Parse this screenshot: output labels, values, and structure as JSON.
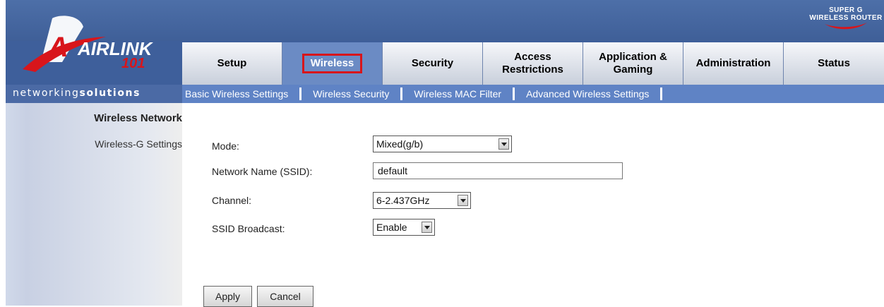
{
  "brand": {
    "line1": "SUPER G",
    "line2": "WIRELESS ROUTER"
  },
  "logo": {
    "text_main": "AIRLINK",
    "text_num": "101"
  },
  "tagline": {
    "thin": "networking",
    "bold": "solutions"
  },
  "tabs": [
    {
      "label": "Setup"
    },
    {
      "label": "Wireless"
    },
    {
      "label": "Security"
    },
    {
      "label": "Access Restrictions"
    },
    {
      "label": "Application & Gaming"
    },
    {
      "label": "Administration"
    },
    {
      "label": "Status"
    }
  ],
  "subnav": [
    {
      "label": "Basic Wireless Settings"
    },
    {
      "label": "Wireless Security"
    },
    {
      "label": "Wireless MAC Filter"
    },
    {
      "label": "Advanced Wireless Settings"
    }
  ],
  "sidebar": {
    "title": "Wireless Network",
    "item": "Wireless-G Settings"
  },
  "form": {
    "mode": {
      "label": "Mode:",
      "value": "Mixed(g/b)"
    },
    "ssid": {
      "label": "Network Name (SSID):",
      "value": "default"
    },
    "channel": {
      "label": "Channel:",
      "value": "6-2.437GHz"
    },
    "broadcast": {
      "label": "SSID Broadcast:",
      "value": "Enable"
    }
  },
  "buttons": {
    "apply": "Apply",
    "cancel": "Cancel"
  },
  "colors": {
    "header": "#3e5f9b",
    "active_tab": "#6b8bc4",
    "highlight": "#d8151b",
    "subnav": "#5f83c5"
  }
}
